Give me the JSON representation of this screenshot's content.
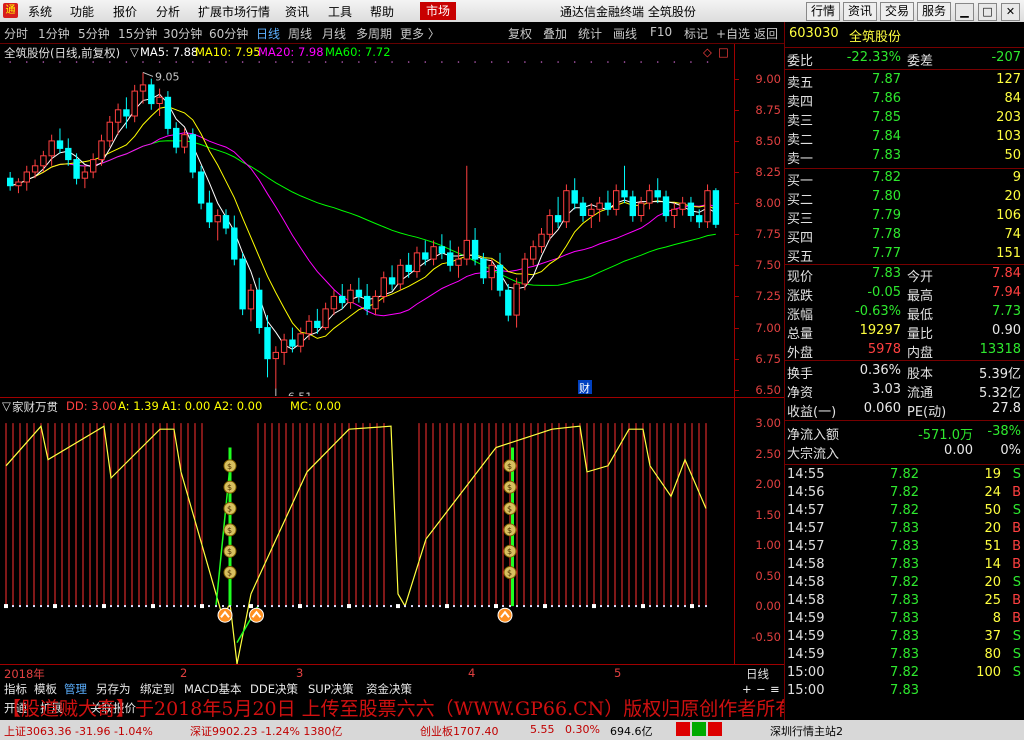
{
  "menubar": {
    "items": [
      "系统",
      "功能",
      "报价",
      "分析",
      "扩展市场行情",
      "资讯",
      "工具",
      "帮助"
    ],
    "market": "市场",
    "title": "通达信金融终端  全筑股份",
    "right_buttons": [
      "行情",
      "资讯",
      "交易",
      "服务"
    ]
  },
  "periods": [
    "分时",
    "1分钟",
    "5分钟",
    "15分钟",
    "30分钟",
    "60分钟",
    "日线",
    "周线",
    "月线",
    "多周期",
    "更多"
  ],
  "active_period": "日线",
  "toolbar": [
    "复权",
    "叠加",
    "统计",
    "画线",
    "F10",
    "标记",
    "+自选",
    "返回"
  ],
  "ma_bar": {
    "stock": "全筑股份(日线,前复权)",
    "ma5": "MA5: 7.88",
    "ma10": "MA10: 7.95",
    "ma20": "MA20: 7.98",
    "ma60": "MA60: 7.72"
  },
  "colors": {
    "ma5": "#ffffff",
    "ma10": "#ffff00",
    "ma20": "#ff00ff",
    "ma60": "#00ff00",
    "up": "#ff4040",
    "down": "#00ffff"
  },
  "price_axis": {
    "ticks": [
      "9.00",
      "8.75",
      "8.50",
      "8.25",
      "8.00",
      "7.75",
      "7.50",
      "7.25",
      "7.00",
      "6.75",
      "6.50"
    ],
    "high_label": "9.05",
    "low_label": "6.51",
    "marker": "财"
  },
  "indicator_bar": {
    "name": "家财万贯",
    "dd": "DD: 3.00",
    "a": "A: 1.39",
    "a1": "A1: 0.00",
    "a2": "A2: 0.00",
    "mc": "MC: 0.00"
  },
  "ind_axis": {
    "ticks": [
      "3.00",
      "2.50",
      "2.00",
      "1.50",
      "1.00",
      "0.50",
      "0.00",
      "-0.50"
    ]
  },
  "date_bar": {
    "labels": [
      "2018年",
      "2",
      "3",
      "4",
      "5"
    ],
    "period": "日线"
  },
  "tabs": [
    "指标",
    "模板",
    "管理",
    "另存为",
    "绑定到",
    "MACD基本",
    "DDE决策",
    "SUP决策",
    "资金决策"
  ],
  "tabs2": [
    "开通",
    "扩展",
    "关联报价"
  ],
  "right_panel": {
    "code": "603030",
    "name": "全筑股份",
    "weibi_label": "委比",
    "weibi": "-22.33%",
    "weicha_label": "委差",
    "weicha": "-207",
    "asks": [
      {
        "label": "卖五",
        "price": "7.87",
        "vol": "127"
      },
      {
        "label": "卖四",
        "price": "7.86",
        "vol": "84"
      },
      {
        "label": "卖三",
        "price": "7.85",
        "vol": "203"
      },
      {
        "label": "卖二",
        "price": "7.84",
        "vol": "103"
      },
      {
        "label": "卖一",
        "price": "7.83",
        "vol": "50"
      }
    ],
    "bids": [
      {
        "label": "买一",
        "price": "7.82",
        "vol": "9"
      },
      {
        "label": "买二",
        "price": "7.80",
        "vol": "20"
      },
      {
        "label": "买三",
        "price": "7.79",
        "vol": "106"
      },
      {
        "label": "买四",
        "price": "7.78",
        "vol": "74"
      },
      {
        "label": "买五",
        "price": "7.77",
        "vol": "151"
      }
    ],
    "quote": [
      {
        "l1": "现价",
        "v1": "7.83",
        "l2": "今开",
        "v2": "7.84"
      },
      {
        "l1": "涨跌",
        "v1": "-0.05",
        "l2": "最高",
        "v2": "7.94"
      },
      {
        "l1": "涨幅",
        "v1": "-0.63%",
        "l2": "最低",
        "v2": "7.73"
      },
      {
        "l1": "总量",
        "v1": "19297",
        "l2": "量比",
        "v2": "0.90"
      },
      {
        "l1": "外盘",
        "v1": "5978",
        "l2": "内盘",
        "v2": "13318"
      }
    ],
    "fund": [
      {
        "l1": "换手",
        "v1": "0.36%",
        "l2": "股本",
        "v2": "5.39亿"
      },
      {
        "l1": "净资",
        "v1": "3.03",
        "l2": "流通",
        "v2": "5.32亿"
      },
      {
        "l1": "收益(一)",
        "v1": "0.060",
        "l2": "PE(动)",
        "v2": "27.8"
      }
    ],
    "flow": {
      "l1": "净流入额",
      "v1": "-571.0万",
      "v1b": "-38%",
      "l2": "大宗流入",
      "v2": "0.00",
      "v2b": "0%"
    },
    "ticks": [
      {
        "t": "14:55",
        "p": "7.82",
        "v": "19",
        "s": "S"
      },
      {
        "t": "14:56",
        "p": "7.82",
        "v": "24",
        "s": "B"
      },
      {
        "t": "14:57",
        "p": "7.82",
        "v": "50",
        "s": "S"
      },
      {
        "t": "14:57",
        "p": "7.83",
        "v": "20",
        "s": "B"
      },
      {
        "t": "14:57",
        "p": "7.83",
        "v": "51",
        "s": "B"
      },
      {
        "t": "14:58",
        "p": "7.83",
        "v": "14",
        "s": "B"
      },
      {
        "t": "14:58",
        "p": "7.82",
        "v": "20",
        "s": "S"
      },
      {
        "t": "14:58",
        "p": "7.83",
        "v": "25",
        "s": "B"
      },
      {
        "t": "14:59",
        "p": "7.83",
        "v": "8",
        "s": "B"
      },
      {
        "t": "14:59",
        "p": "7.83",
        "v": "37",
        "s": "S"
      },
      {
        "t": "14:59",
        "p": "7.83",
        "v": "80",
        "s": "S"
      },
      {
        "t": "15:00",
        "p": "7.82",
        "v": "100",
        "s": "S"
      },
      {
        "t": "15:00",
        "p": "7.83",
        "v": "",
        "s": ""
      }
    ]
  },
  "watermark": "【股道贼大奇】于2018年5月20日 上传至股票六六（WWW.GP66.CN）版权归原创作者所有",
  "status_bar": {
    "left": "上证3063.36  -31.96  -1.04%",
    "mid": "深证9902.23  -1.24%  1380亿",
    "mid2": "创业板1707.40",
    "right1": "5.55",
    "right2": "0.30%",
    "right3": "694.6亿",
    "server": "深圳行情主站2"
  },
  "chart_data": {
    "type": "candlestick",
    "title": "全筑股份(日线,前复权)",
    "ylim": [
      6.45,
      9.15
    ],
    "period_high": 9.05,
    "period_low": 6.51,
    "ma": {
      "MA5": 7.88,
      "MA10": 7.95,
      "MA20": 7.98,
      "MA60": 7.72
    },
    "candles": [
      [
        8.2,
        8.25,
        8.1,
        8.14
      ],
      [
        8.14,
        8.2,
        8.08,
        8.17
      ],
      [
        8.17,
        8.3,
        8.1,
        8.25
      ],
      [
        8.25,
        8.35,
        8.2,
        8.3
      ],
      [
        8.3,
        8.42,
        8.25,
        8.38
      ],
      [
        8.38,
        8.55,
        8.3,
        8.5
      ],
      [
        8.5,
        8.6,
        8.4,
        8.44
      ],
      [
        8.44,
        8.52,
        8.3,
        8.35
      ],
      [
        8.35,
        8.4,
        8.15,
        8.2
      ],
      [
        8.2,
        8.3,
        8.12,
        8.25
      ],
      [
        8.25,
        8.4,
        8.2,
        8.35
      ],
      [
        8.35,
        8.55,
        8.3,
        8.5
      ],
      [
        8.5,
        8.7,
        8.45,
        8.65
      ],
      [
        8.65,
        8.8,
        8.55,
        8.75
      ],
      [
        8.75,
        8.85,
        8.6,
        8.7
      ],
      [
        8.7,
        8.95,
        8.65,
        8.9
      ],
      [
        8.9,
        9.05,
        8.8,
        8.95
      ],
      [
        8.95,
        9.0,
        8.75,
        8.8
      ],
      [
        8.8,
        8.92,
        8.7,
        8.85
      ],
      [
        8.85,
        8.9,
        8.55,
        8.6
      ],
      [
        8.6,
        8.65,
        8.4,
        8.45
      ],
      [
        8.45,
        8.6,
        8.4,
        8.55
      ],
      [
        8.55,
        8.6,
        8.2,
        8.25
      ],
      [
        8.25,
        8.3,
        7.95,
        8.0
      ],
      [
        8.0,
        8.1,
        7.8,
        7.85
      ],
      [
        7.85,
        7.95,
        7.7,
        7.9
      ],
      [
        7.9,
        7.95,
        7.75,
        7.8
      ],
      [
        7.8,
        7.9,
        7.5,
        7.55
      ],
      [
        7.55,
        7.6,
        7.1,
        7.15
      ],
      [
        7.15,
        7.35,
        7.05,
        7.3
      ],
      [
        7.3,
        7.4,
        6.95,
        7.0
      ],
      [
        7.0,
        7.1,
        6.6,
        6.75
      ],
      [
        6.75,
        6.85,
        6.51,
        6.8
      ],
      [
        6.8,
        6.95,
        6.7,
        6.9
      ],
      [
        6.9,
        7.0,
        6.8,
        6.85
      ],
      [
        6.85,
        7.0,
        6.8,
        6.95
      ],
      [
        6.95,
        7.1,
        6.9,
        7.05
      ],
      [
        7.05,
        7.15,
        6.95,
        7.0
      ],
      [
        7.0,
        7.2,
        6.98,
        7.15
      ],
      [
        7.15,
        7.3,
        7.1,
        7.25
      ],
      [
        7.25,
        7.35,
        7.15,
        7.2
      ],
      [
        7.2,
        7.35,
        7.15,
        7.3
      ],
      [
        7.3,
        7.4,
        7.2,
        7.25
      ],
      [
        7.25,
        7.35,
        7.1,
        7.15
      ],
      [
        7.15,
        7.3,
        7.1,
        7.25
      ],
      [
        7.25,
        7.45,
        7.2,
        7.4
      ],
      [
        7.4,
        7.5,
        7.3,
        7.35
      ],
      [
        7.35,
        7.55,
        7.3,
        7.5
      ],
      [
        7.5,
        7.6,
        7.4,
        7.45
      ],
      [
        7.45,
        7.65,
        7.4,
        7.6
      ],
      [
        7.6,
        7.7,
        7.5,
        7.55
      ],
      [
        7.55,
        7.7,
        7.5,
        7.65
      ],
      [
        7.65,
        7.75,
        7.55,
        7.6
      ],
      [
        7.6,
        7.7,
        7.45,
        7.5
      ],
      [
        7.5,
        7.65,
        7.4,
        7.55
      ],
      [
        7.55,
        8.3,
        7.5,
        7.7
      ],
      [
        7.7,
        7.8,
        7.5,
        7.55
      ],
      [
        7.55,
        7.6,
        7.35,
        7.4
      ],
      [
        7.4,
        7.55,
        7.3,
        7.5
      ],
      [
        7.5,
        7.6,
        7.25,
        7.3
      ],
      [
        7.3,
        7.35,
        7.05,
        7.1
      ],
      [
        7.1,
        7.4,
        7.0,
        7.35
      ],
      [
        7.35,
        7.6,
        7.3,
        7.55
      ],
      [
        7.55,
        7.7,
        7.5,
        7.65
      ],
      [
        7.65,
        7.8,
        7.6,
        7.75
      ],
      [
        7.75,
        7.95,
        7.7,
        7.9
      ],
      [
        7.9,
        8.05,
        7.8,
        7.85
      ],
      [
        7.85,
        8.15,
        7.8,
        8.1
      ],
      [
        8.1,
        8.2,
        7.95,
        8.0
      ],
      [
        8.0,
        8.05,
        7.85,
        7.9
      ],
      [
        7.9,
        8.0,
        7.8,
        7.95
      ],
      [
        7.95,
        8.05,
        7.85,
        8.0
      ],
      [
        8.0,
        8.1,
        7.9,
        7.95
      ],
      [
        7.95,
        8.15,
        7.9,
        8.1
      ],
      [
        8.1,
        8.3,
        8.0,
        8.05
      ],
      [
        8.05,
        8.1,
        7.85,
        7.9
      ],
      [
        7.9,
        8.05,
        7.85,
        8.0
      ],
      [
        8.0,
        8.15,
        7.95,
        8.1
      ],
      [
        8.1,
        8.2,
        8.0,
        8.05
      ],
      [
        8.05,
        8.1,
        7.85,
        7.9
      ],
      [
        7.9,
        8.0,
        7.8,
        7.95
      ],
      [
        7.95,
        8.05,
        7.9,
        8.0
      ],
      [
        8.0,
        8.05,
        7.85,
        7.9
      ],
      [
        7.9,
        7.95,
        7.8,
        7.85
      ],
      [
        7.85,
        8.15,
        7.8,
        8.1
      ],
      [
        8.1,
        8.12,
        7.8,
        7.83
      ]
    ]
  }
}
